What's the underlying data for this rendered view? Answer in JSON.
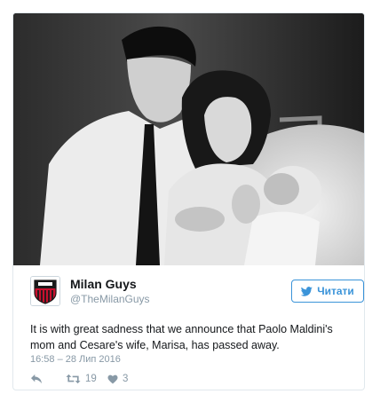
{
  "tweet": {
    "author": {
      "display_name": "Milan Guys",
      "screen_name": "@TheMilanGuys"
    },
    "follow_label": "Читати",
    "text": "It is with great sadness that we announce that Paolo Maldini's mom and Cesare's wife, Marisa, has passed away.",
    "timestamp": "16:58 – 28 Лип 2016",
    "actions": {
      "reply_icon": "reply-icon",
      "retweet_icon": "retweet-icon",
      "retweet_count": "19",
      "like_icon": "heart-icon",
      "like_count": "3"
    }
  },
  "colors": {
    "link_blue": "#3b94d9",
    "secondary_text": "#8899a6",
    "border": "#e1e8ed",
    "milan_red": "#c8102e"
  }
}
